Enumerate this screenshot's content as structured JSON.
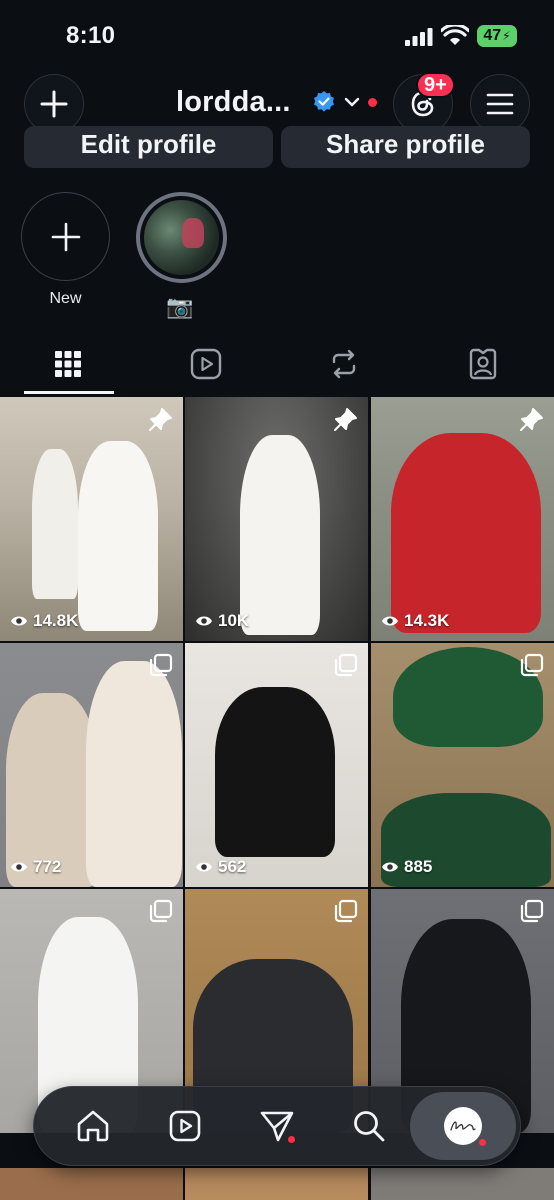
{
  "status_bar": {
    "time": "8:10",
    "battery": "47"
  },
  "header": {
    "username": "lordda...",
    "notification_badge": "9+"
  },
  "profile_actions": {
    "edit_label": "Edit profile",
    "share_label": "Share profile"
  },
  "highlights": [
    {
      "label": "New"
    },
    {
      "label": "📷"
    }
  ],
  "tabs": [
    "grid-icon",
    "reels-icon",
    "reposts-icon",
    "tagged-icon"
  ],
  "posts": [
    {
      "views": "14.8K",
      "corner_icon": "pin-icon"
    },
    {
      "views": "10K",
      "corner_icon": "pin-icon"
    },
    {
      "views": "14.3K",
      "corner_icon": "pin-icon"
    },
    {
      "views": "772",
      "corner_icon": "multi-photo-icon"
    },
    {
      "views": "562",
      "corner_icon": "multi-photo-icon"
    },
    {
      "views": "885",
      "corner_icon": "multi-photo-icon"
    },
    {
      "views": "",
      "corner_icon": "multi-photo-icon"
    },
    {
      "views": "",
      "corner_icon": "multi-photo-icon"
    },
    {
      "views": "",
      "corner_icon": "multi-photo-icon"
    }
  ],
  "bottom_nav": [
    "home-icon",
    "reels-icon",
    "direct-message-icon",
    "search-icon",
    "profile-avatar"
  ],
  "colors": {
    "background": "#0b0f14",
    "accent_red": "#ff2d45",
    "verified_blue": "#3897f0",
    "battery_green": "#5cd16a"
  }
}
